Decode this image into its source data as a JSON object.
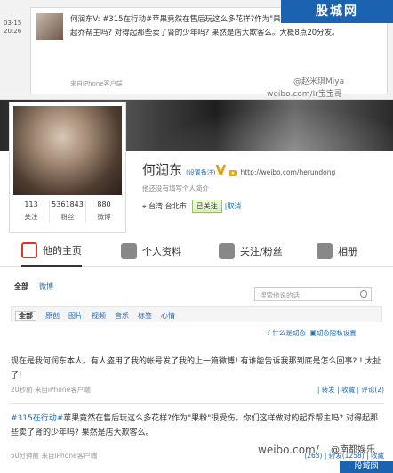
{
  "repost": {
    "time": "03-15\n20:26",
    "text": "何润东V: #315在行动#苹果竟然在售后玩这么多花样?作为\"果粉\"很受伤。你们这样做对的起乔帮主吗? 对得起那些卖了肾的少年吗? 果然是店大欺客么。大概8点20分发。",
    "source": "来自iPhone客户端"
  },
  "watermarks": {
    "top_site": "股城网",
    "mid1": "@赵米琪Miya",
    "mid2": "weibo.com/Ir宝宝哥",
    "bottom1": "weibo.com/",
    "bottom2": "@南都娱乐",
    "bottom_site": "股城网"
  },
  "profile": {
    "name": "何润东",
    "set_remark": "(设置备注)",
    "vip": "V",
    "url": "http://weibo.com/herundong",
    "intro": "他还没有填写个人简介",
    "location": "台湾 台北市",
    "follow_status": "已关注",
    "cancel": "取消",
    "stats": [
      {
        "num": "113",
        "label": "关注"
      },
      {
        "num": "5361843",
        "label": "粉丝"
      },
      {
        "num": "880",
        "label": "微博"
      }
    ]
  },
  "tabs": [
    {
      "label": "他的主页",
      "color": "#d33"
    },
    {
      "label": "个人资料",
      "color": "#888"
    },
    {
      "label": "关注/粉丝",
      "color": "#888"
    },
    {
      "label": "相册",
      "color": "#888"
    }
  ],
  "subtabs": [
    "全部",
    "微博"
  ],
  "search_placeholder": "搜索他说的话",
  "filters": [
    "全部",
    "原创",
    "图片",
    "视频",
    "音乐",
    "标签",
    "心情"
  ],
  "meta_links": {
    "what": "什么是动态",
    "settings": "动态隐私设置"
  },
  "posts": [
    {
      "text": "现在是我何润东本人。有人盗用了我的帐号发了我的上一篇微博! 有谁能告诉我那到底是怎么回事? ! 太扯了!",
      "time": "20秒前",
      "source": "来自iPhone客户端",
      "actions": "| 转发 | 收藏 | 评论(2)"
    },
    {
      "hash": "#315在行动#",
      "text": "苹果竟然在售后玩这么多花样?作为\"果粉\"很受伤。你们这样做对的起乔帮主吗? 对得起那些卖了肾的少年吗? 果然是店大欺客么。",
      "time": "50分钟前",
      "source": "来自iPhone客户端",
      "actions": "(263) | 转发(1258) | 收藏"
    }
  ]
}
